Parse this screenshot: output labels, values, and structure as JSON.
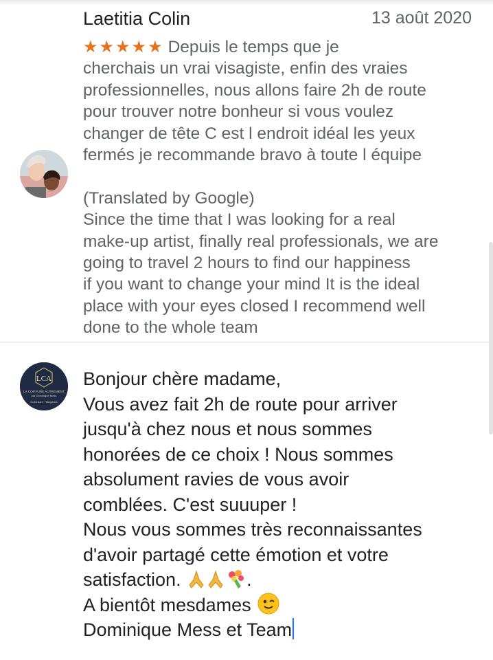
{
  "review": {
    "author": "Laetitia Colin",
    "date": "13 août 2020",
    "rating": 5,
    "stars": "★★★★★",
    "lines": [
      "Depuis le temps que je",
      "cherchais un vrai visagiste, enfin des vraies",
      "professionnelles, nous allons faire 2h de route",
      "pour trouver notre bonheur si vous voulez",
      "changer de tête C est l endroit idéal les yeux",
      "fermés je recommande bravo à toute l équipe"
    ],
    "translation_label": "(Translated by Google)",
    "translation_lines": [
      "Since the time that I was looking for a real",
      "make-up artist, finally real professionals, we are",
      "going to travel 2 hours to find our happiness",
      "if you want to change your mind It is the ideal",
      "place with your eyes closed I recommend well",
      "done to the whole team"
    ]
  },
  "owner": {
    "logo_initials": "LCA",
    "logo_line1": "LA COIFFURE AUTREMENT",
    "logo_line2": "par Dominique Mess",
    "logo_line3": "Coloristes - Visagistes",
    "reply_lines": [
      "Bonjour chère madame,",
      "Vous avez fait 2h de route pour arriver",
      "jusqu'à chez nous et nous sommes",
      "honorées de ce choix ! Nous sommes",
      "absolument ravies de vous avoir",
      "comblées. C'est suuuper !",
      "Nous vous sommes très reconnaissantes",
      "d'avoir partagé cette émotion et votre",
      "satisfaction.",
      "A bientôt mesdames",
      "Dominique Mess et Team"
    ],
    "after_emojis": "."
  },
  "colors": {
    "star": "#e8711a",
    "review_text": "#5f6368",
    "reply_text": "#202124",
    "cursor": "#1a73e8",
    "logo_bg": "#1f2a44",
    "logo_gold": "#c9a45c"
  }
}
